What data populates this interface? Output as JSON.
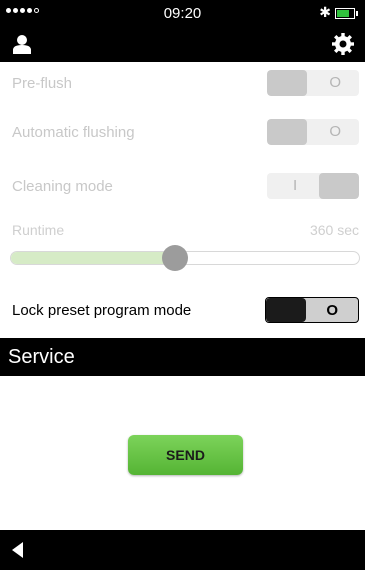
{
  "status_bar": {
    "time": "09:20",
    "bluetooth_icon": "bluetooth-icon"
  },
  "nav": {
    "user_icon": "user-icon",
    "settings_icon": "gear-icon"
  },
  "settings": {
    "pre_flush": {
      "label": "Pre-flush",
      "state_text": "O",
      "state": "off"
    },
    "automatic_flushing": {
      "label": "Automatic flushing",
      "state_text": "O",
      "state": "off"
    },
    "cleaning_mode": {
      "label": "Cleaning mode",
      "state_text": "I",
      "state": "on"
    },
    "runtime": {
      "label": "Runtime",
      "value": "360 sec",
      "slider_fraction": 0.47
    },
    "lock_preset": {
      "label": "Lock preset program mode",
      "state_text": "O",
      "state": "off"
    }
  },
  "service": {
    "title": "Service",
    "send_label": "SEND"
  },
  "colors": {
    "send_button": "#5fbf3e",
    "slider_fill": "#d6ebc6",
    "battery": "#31c23d"
  }
}
